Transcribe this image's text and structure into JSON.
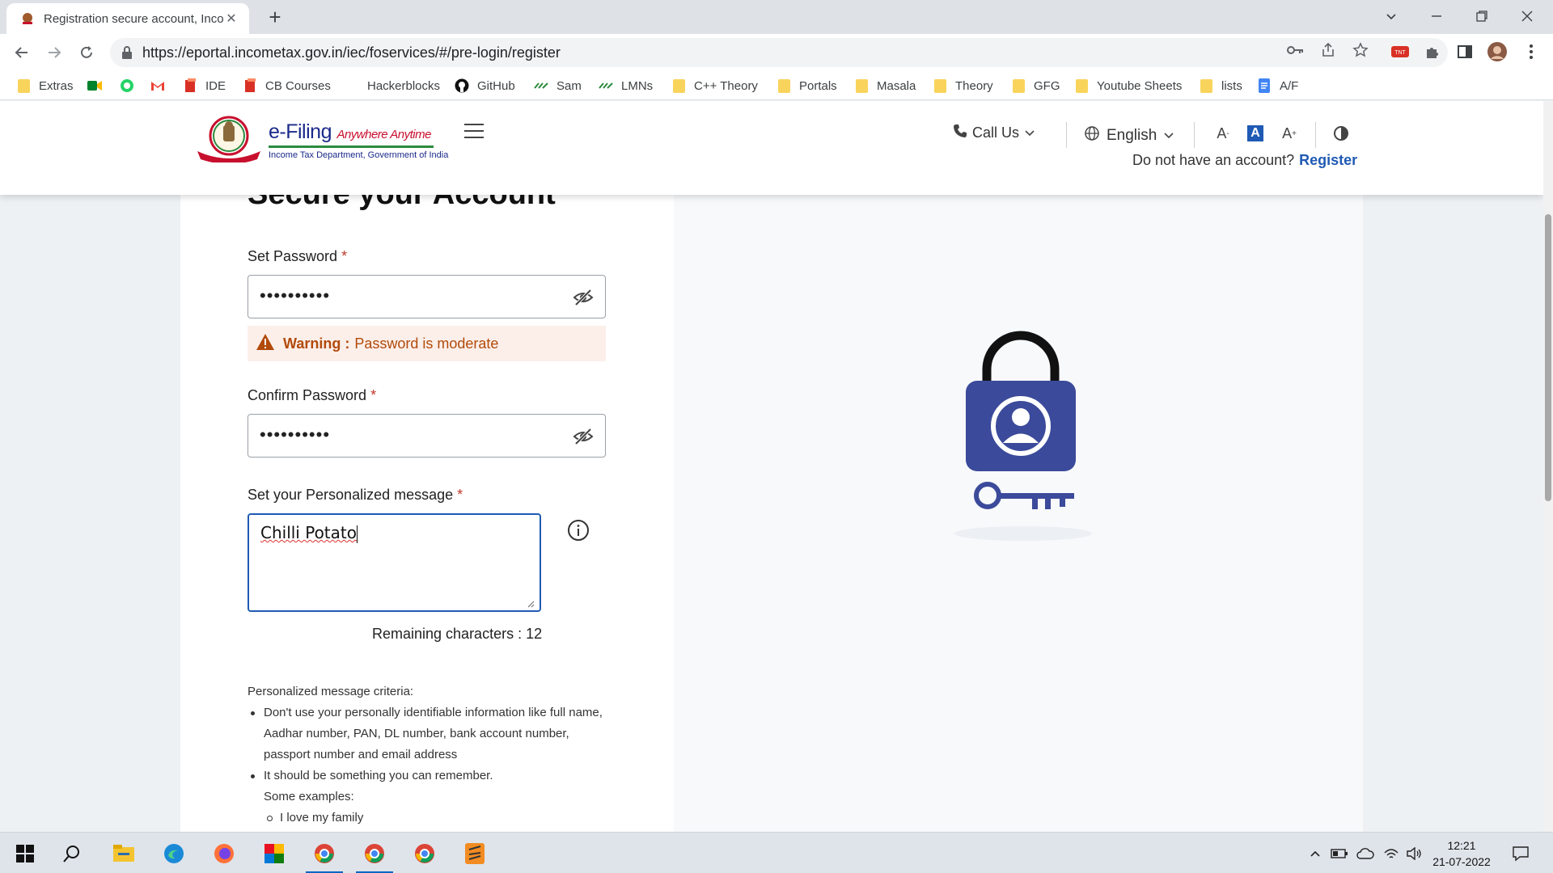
{
  "browser": {
    "tab_title": "Registration secure account, Inco",
    "url": "https://eportal.incometax.gov.in/iec/foservices/#/pre-login/register",
    "bookmarks": [
      "Extras",
      "IDE",
      "CB Courses",
      "Hackerblocks",
      "GitHub",
      "Sam",
      "LMNs",
      "C++ Theory",
      "Portals",
      "Masala",
      "Theory",
      "GFG",
      "Youtube Sheets",
      "lists",
      "A/F"
    ]
  },
  "header": {
    "brand_title": "e-Filing",
    "brand_tagline": "Anywhere Anytime",
    "brand_subtitle": "Income Tax Department, Government of India",
    "call_us": "Call Us",
    "language": "English",
    "font_small": "A",
    "font_normal": "A",
    "font_large": "A",
    "no_account_text": "Do not have an account?",
    "register_link": "Register"
  },
  "form": {
    "heading": "Secure your Account",
    "set_password_label": "Set Password",
    "set_password_value": "••••••••••",
    "warning_label": "Warning :",
    "warning_text": "Password is moderate",
    "confirm_password_label": "Confirm Password",
    "confirm_password_value": "••••••••••",
    "message_label": "Set your Personalized message",
    "message_value": "Chilli Potato",
    "required_mark": "*",
    "remaining_chars": "Remaining characters : 12"
  },
  "criteria": {
    "title": "Personalized message criteria:",
    "items": [
      "Don't use your personally identifiable information like full name, Aadhar number, PAN, DL number, bank account number, passport number and email address",
      "It should be something you can remember."
    ],
    "examples_label": "Some examples:",
    "example_items": [
      "I love my family"
    ]
  },
  "taskbar": {
    "time": "12:21",
    "date": "21-07-2022"
  },
  "colors": {
    "brand_blue": "#1f5ab4",
    "lock_blue": "#3b4a9a",
    "warning_orange": "#b24a0a",
    "required_red": "#c0392b"
  }
}
